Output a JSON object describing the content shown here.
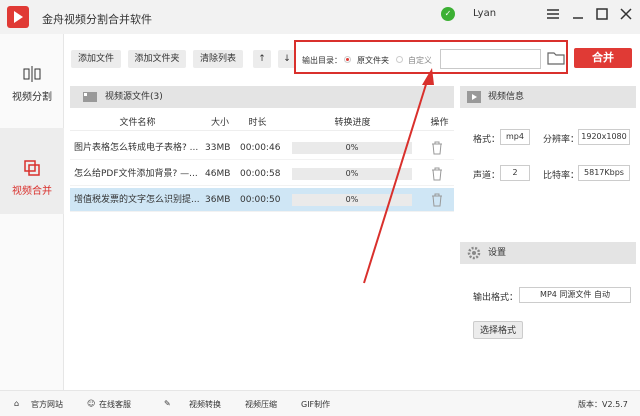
{
  "app": {
    "title": "金舟视频分割合并软件",
    "user": "Lyan"
  },
  "sidebar": {
    "items": [
      {
        "label": "视频分割"
      },
      {
        "label": "视频合并"
      }
    ]
  },
  "toolbar": {
    "add_file": "添加文件",
    "add_folder": "添加文件夹",
    "clear_list": "清除列表",
    "output_dir_label": "输出目录：",
    "opt_source": "原文件夹",
    "opt_custom": "自定义",
    "path_value": "",
    "merge": "合并"
  },
  "list": {
    "title": "视频源文件(3)",
    "headers": {
      "name": "文件名称",
      "size": "大小",
      "duration": "时长",
      "progress": "转换进度",
      "action": "操作"
    },
    "rows": [
      {
        "name": "图片表格怎么转成电子表格? ...",
        "size": "33MB",
        "duration": "00:00:46",
        "progress": "0%"
      },
      {
        "name": "怎么给PDF文件添加背景? —...",
        "size": "46MB",
        "duration": "00:00:58",
        "progress": "0%"
      },
      {
        "name": "增值税发票的文字怎么识别提...",
        "size": "36MB",
        "duration": "00:00:50",
        "progress": "0%"
      }
    ]
  },
  "video_info": {
    "title": "视频信息",
    "format_label": "格式：",
    "format": "mp4",
    "resolution_label": "分辨率：",
    "resolution": "1920x1080",
    "channel_label": "声道：",
    "channel": "2",
    "bitrate_label": "比特率：",
    "bitrate": "5817Kbps"
  },
  "settings": {
    "title": "设置",
    "output_format_label": "输出格式：",
    "output_format": "MP4 同源文件 自动",
    "choose_format": "选择格式"
  },
  "bottom": {
    "website": "官方网站",
    "support": "在线客服",
    "convert": "视频转换",
    "compress": "视频压缩",
    "gif": "GIF制作",
    "version": "版本：V2.5.7"
  }
}
